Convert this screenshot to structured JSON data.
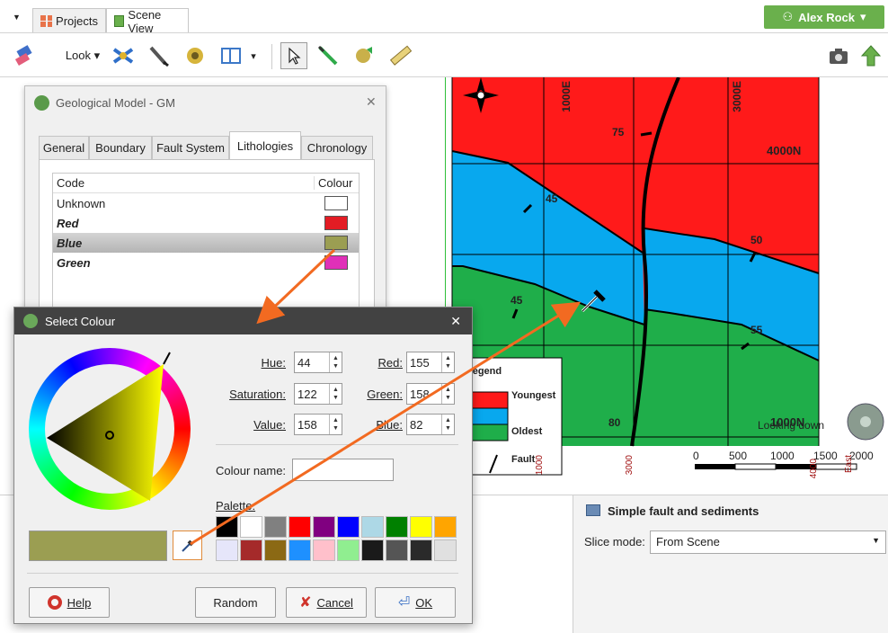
{
  "tabs": {
    "menu_arrow": "▼",
    "projects": "Projects",
    "scene_view": "Scene View"
  },
  "user": {
    "name": "Alex Rock",
    "arrow": "▾"
  },
  "toolbar": {
    "look_label": "Look ▾",
    "panel_arrow": "▾"
  },
  "map": {
    "north_labels": [
      "1000E",
      "3000E"
    ],
    "labels": {
      "n4000": "4000N",
      "n1000": "1000N",
      "d75": "75",
      "d45a": "45",
      "d45b": "45",
      "d50": "50",
      "d55": "55",
      "d80": "80"
    },
    "looking": "Looking down",
    "legend": {
      "title": "Legend",
      "youngest": "Youngest",
      "oldest": "Oldest",
      "fault": "Fault"
    },
    "scalebar": [
      "0",
      "500",
      "1000",
      "1500",
      "2000"
    ],
    "axis_bits": [
      "1000",
      "3000",
      "4000",
      "East"
    ]
  },
  "geo_dialog": {
    "title": "Geological Model - GM",
    "close": "✕",
    "tabs": [
      "General",
      "Boundary",
      "Fault System",
      "Lithologies",
      "Chronology"
    ],
    "table": {
      "headers": {
        "code": "Code",
        "colour": "Colour"
      },
      "rows": [
        {
          "code": "Unknown",
          "colour": "#ffffff"
        },
        {
          "code": "Red",
          "colour": "#e31c24"
        },
        {
          "code": "Blue",
          "colour": "#9b9e52"
        },
        {
          "code": "Green",
          "colour": "#e030b8"
        }
      ]
    }
  },
  "colour_dialog": {
    "title": "Select Colour",
    "close": "✕",
    "fields": {
      "hue": {
        "label": "Hue:",
        "value": "44"
      },
      "saturation": {
        "label": "Saturation:",
        "value": "122"
      },
      "value": {
        "label": "Value:",
        "value": "158"
      },
      "red": {
        "label": "Red:",
        "value": "155"
      },
      "green": {
        "label": "Green:",
        "value": "158"
      },
      "blue": {
        "label": "Blue:",
        "value": "82"
      }
    },
    "colour_name_label": "Colour name:",
    "colour_name_value": "",
    "palette_label": "Palette:",
    "palette": [
      "#000000",
      "#ffffff",
      "#808080",
      "#ff0000",
      "#800080",
      "#0000ff",
      "#add8e6",
      "#008000",
      "#ffff00",
      "#ffa500",
      "#e6e6fa",
      "#a52a2a",
      "#8b6914",
      "#1e90ff",
      "#ffc0cb",
      "#90ee90",
      "#1a1a1a",
      "#555555",
      "#2a2a2a",
      "#e0e0e0"
    ],
    "current_colour": "#9b9e52",
    "buttons": {
      "help": "Help",
      "random": "Random",
      "cancel": "Cancel",
      "ok": "OK"
    }
  },
  "bottom_right": {
    "title": "Simple fault and sediments",
    "slice_label": "Slice mode:",
    "slice_value": "From Scene"
  },
  "colors": {
    "accent": "#6ab04c",
    "map_red": "#ff1a1a",
    "map_blue": "#08a8ee",
    "map_green": "#1fae4a",
    "arrow": "#f26a21"
  }
}
